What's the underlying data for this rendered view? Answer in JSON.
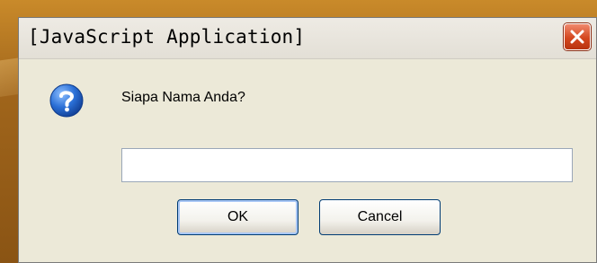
{
  "dialog": {
    "title": "[JavaScript Application]",
    "prompt": "Siapa Nama Anda?",
    "input_value": "",
    "icon": "question-icon",
    "close_icon": "close-icon",
    "ok_label": "OK",
    "cancel_label": "Cancel"
  },
  "colors": {
    "desktop_background": "#a0651b",
    "dialog_background": "#ece9d8",
    "close_button": "#d4471f",
    "question_icon": "#2a6fd6"
  }
}
